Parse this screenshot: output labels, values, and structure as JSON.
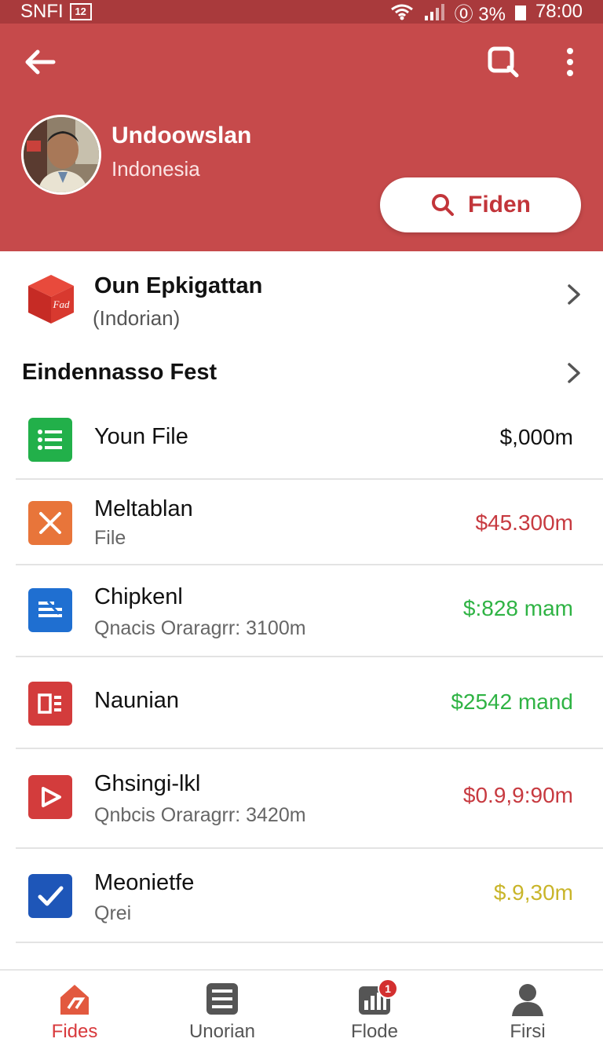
{
  "status_bar": {
    "carrier": "SNFI",
    "sim_label": "12",
    "battery_text": "⓪ 3%",
    "time": "78:00"
  },
  "profile": {
    "name": "Undoowslan",
    "country": "Indonesia",
    "find_button": "Fiden"
  },
  "organization": {
    "title": "Oun Epkigattan",
    "subtitle": "(Indorian)",
    "icon_text": "Fad"
  },
  "section_title": "Eindennasso Fest",
  "items": [
    {
      "title": "Youn File",
      "subtitle": "",
      "amount": "$,000m",
      "amount_color": "#111111",
      "icon": "list-icon",
      "icon_color": "#22b04a"
    },
    {
      "title": "Meltablan",
      "subtitle": "File",
      "amount": "$45.300m",
      "amount_color": "#c73a40",
      "icon": "x-icon",
      "icon_color": "#e8753a"
    },
    {
      "title": "Chipkenl",
      "subtitle": "Qnacis Oraragrr: 3100m",
      "amount": "$:828 mam",
      "amount_color": "#2fb344",
      "icon": "document-icon",
      "icon_color": "#1f6fd1"
    },
    {
      "title": "Naunian",
      "subtitle": "",
      "amount": "$2542 mand",
      "amount_color": "#2fb344",
      "icon": "form-icon",
      "icon_color": "#d33c3c"
    },
    {
      "title": "Ghsingi-lkl",
      "subtitle": "Qnbcis Oraragrr: 3420m",
      "amount": "$0.9,9:90m",
      "amount_color": "#c73a40",
      "icon": "play-icon",
      "icon_color": "#d33c3c"
    },
    {
      "title": "Meonietfe",
      "subtitle": "Qrei",
      "amount": "$.9,30m",
      "amount_color": "#c9b52a",
      "icon": "check-icon",
      "icon_color": "#1e56b8"
    }
  ],
  "nav": [
    {
      "label": "Fides",
      "icon": "home-icon",
      "active": true
    },
    {
      "label": "Unorian",
      "icon": "calculator-icon",
      "active": false
    },
    {
      "label": "Flode",
      "icon": "bar-chart-icon",
      "active": false,
      "badge": "1"
    },
    {
      "label": "Firsi",
      "icon": "person-icon",
      "active": false
    }
  ],
  "colors": {
    "header": "#c64a4b",
    "status_bar": "#a93a3c",
    "accent": "#c2353a"
  }
}
